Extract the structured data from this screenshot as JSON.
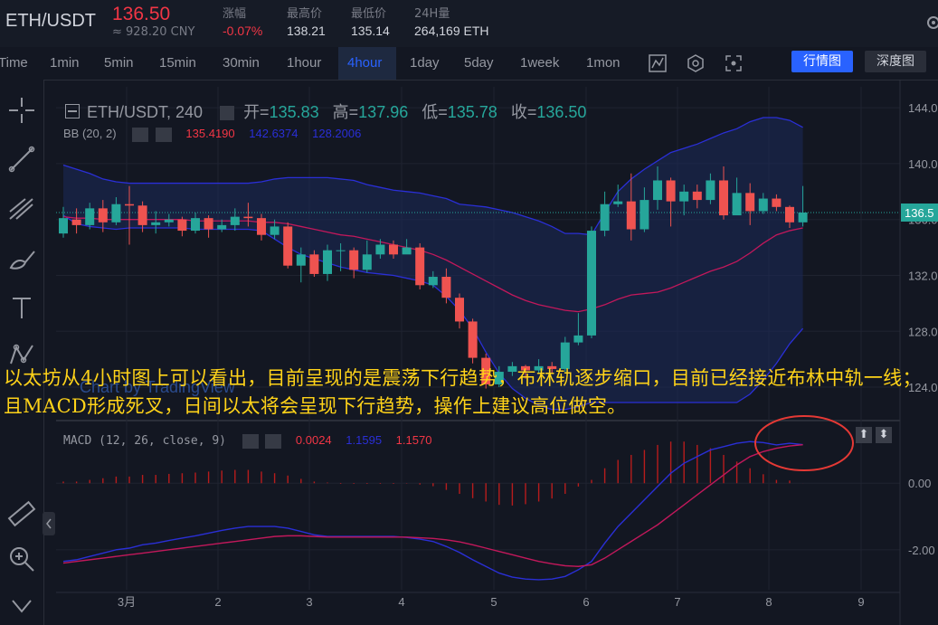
{
  "header": {
    "pair": "ETH/USDT",
    "price": "136.50",
    "cny": "≈ 928.20 CNY",
    "stats": [
      {
        "label": "涨幅",
        "value": "-0.07%",
        "color": "#f23645"
      },
      {
        "label": "最高价",
        "value": "138.21",
        "color": "#d1d4dc"
      },
      {
        "label": "最低价",
        "value": "135.14",
        "color": "#d1d4dc"
      },
      {
        "label": "24H量",
        "value": "264,169 ETH",
        "color": "#d1d4dc"
      }
    ]
  },
  "toolbar": {
    "timeframes": [
      "Time",
      "1min",
      "5min",
      "15min",
      "30min",
      "1hour",
      "4hour",
      "1day",
      "5day",
      "1week",
      "1mon"
    ],
    "active": "4hour",
    "view_primary": "行情图",
    "view_secondary": "深度图",
    "icons": [
      "indicator-icon",
      "settings-icon",
      "fullscreen-icon"
    ]
  },
  "drawing_tools": [
    "crosshair-icon",
    "trendline-icon",
    "fork-icon",
    "brush-icon",
    "text-icon",
    "pattern-icon",
    "ruler-icon",
    "zoom-icon",
    "magnet-icon"
  ],
  "legend": {
    "symbol": "ETH/USDT, 240",
    "open_label": "开=",
    "open": "135.83",
    "high_label": "高=",
    "high": "137.96",
    "low_label": "低=",
    "low": "135.78",
    "close_label": "收=",
    "close": "136.50",
    "bb_label": "BB (20, 2)",
    "bb_values": [
      "135.4190",
      "142.6374",
      "128.2006"
    ],
    "watermark": "Chart by TradingView",
    "macd_label": "MACD (12, 26, close, 9)",
    "macd_values": [
      "0.0024",
      "1.1595",
      "1.1570"
    ]
  },
  "annotation": {
    "text": "以太坊从4小时图上可以看出，目前呈现的是震荡下行趋势，布林轨逐步缩口，目前已经接近布林中轨一线；且MACD形成死叉，日间以太将会呈现下行趋势，操作上建议高位做空。"
  },
  "colors": {
    "up": "#26a69a",
    "down": "#ef5350",
    "bb_upper": "#2a2fd6",
    "bb_mid": "#c2185b",
    "macd": "#2a2fd6",
    "signal": "#c2185b",
    "annotation": "#ffd319",
    "circle": "#e53935"
  },
  "chart_data": [
    {
      "type": "candlestick",
      "y_ticks": [
        124,
        128,
        132,
        136,
        140,
        144
      ],
      "ylim": [
        121.8,
        145.5
      ],
      "x_ticks": [
        "3月",
        "2",
        "3",
        "4",
        "5",
        "6",
        "7",
        "8",
        "9"
      ],
      "current_price": 136.5,
      "candles": [
        [
          135.0,
          136.1,
          136.9,
          134.7
        ],
        [
          136.0,
          135.6,
          136.8,
          135.0
        ],
        [
          135.6,
          136.8,
          137.2,
          135.3
        ],
        [
          136.8,
          135.8,
          137.4,
          135.1
        ],
        [
          135.8,
          137.1,
          137.6,
          135.6
        ],
        [
          137.1,
          137.0,
          138.4,
          134.2
        ],
        [
          137.0,
          135.6,
          137.3,
          135.1
        ],
        [
          135.6,
          135.8,
          136.6,
          135.0
        ],
        [
          135.8,
          136.0,
          136.4,
          135.5
        ],
        [
          136.0,
          135.2,
          136.2,
          134.8
        ],
        [
          135.2,
          136.1,
          136.5,
          135.0
        ],
        [
          136.1,
          135.3,
          136.3,
          134.7
        ],
        [
          135.3,
          135.6,
          136.0,
          135.1
        ],
        [
          135.6,
          136.2,
          136.8,
          135.2
        ],
        [
          136.2,
          136.1,
          137.2,
          135.5
        ],
        [
          136.1,
          134.9,
          136.4,
          134.5
        ],
        [
          134.9,
          135.5,
          136.0,
          134.6
        ],
        [
          135.5,
          132.7,
          135.8,
          132.5
        ],
        [
          132.7,
          133.5,
          134.0,
          131.5
        ],
        [
          133.5,
          132.1,
          133.8,
          131.9
        ],
        [
          132.1,
          133.8,
          134.2,
          131.6
        ],
        [
          133.8,
          133.8,
          134.3,
          132.3
        ],
        [
          133.8,
          132.4,
          134.0,
          131.8
        ],
        [
          132.4,
          133.5,
          134.5,
          132.2
        ],
        [
          133.5,
          134.2,
          134.6,
          133.2
        ],
        [
          134.2,
          133.5,
          134.5,
          133.2
        ],
        [
          133.5,
          134.0,
          134.6,
          133.6
        ],
        [
          134.0,
          131.3,
          134.3,
          131.0
        ],
        [
          131.3,
          131.9,
          132.3,
          131.1
        ],
        [
          131.9,
          130.4,
          132.5,
          130.0
        ],
        [
          130.4,
          128.7,
          130.7,
          128.2
        ],
        [
          128.7,
          126.1,
          128.9,
          125.7
        ],
        [
          126.1,
          124.2,
          126.4,
          123.9
        ],
        [
          124.2,
          125.1,
          125.5,
          124.0
        ],
        [
          125.1,
          125.5,
          125.8,
          124.8
        ],
        [
          125.5,
          125.2,
          125.6,
          124.6
        ],
        [
          125.2,
          125.5,
          126.0,
          125.0
        ],
        [
          125.5,
          125.3,
          125.8,
          125.0
        ],
        [
          125.3,
          127.2,
          127.6,
          125.1
        ],
        [
          127.2,
          127.7,
          129.3,
          127.0
        ],
        [
          127.7,
          135.2,
          135.5,
          127.5
        ],
        [
          135.2,
          137.1,
          138.0,
          134.8
        ],
        [
          137.1,
          137.3,
          138.5,
          136.9
        ],
        [
          137.3,
          135.3,
          139.3,
          134.5
        ],
        [
          135.3,
          137.4,
          138.3,
          135.1
        ],
        [
          137.4,
          138.8,
          139.8,
          136.7
        ],
        [
          138.8,
          137.3,
          139.0,
          135.5
        ],
        [
          137.3,
          138.0,
          138.5,
          136.3
        ],
        [
          138.0,
          137.4,
          138.5,
          136.8
        ],
        [
          137.4,
          138.8,
          139.3,
          137.1
        ],
        [
          138.8,
          136.3,
          139.8,
          136.0
        ],
        [
          136.3,
          137.9,
          139.0,
          137.6
        ],
        [
          137.9,
          136.6,
          138.6,
          135.6
        ],
        [
          136.6,
          137.5,
          137.9,
          136.4
        ],
        [
          137.5,
          136.9,
          137.8,
          136.6
        ],
        [
          136.9,
          135.8,
          137.0,
          135.4
        ],
        [
          135.8,
          136.5,
          138.4,
          135.5
        ]
      ],
      "bb_upper": [
        139.9,
        139.6,
        139.3,
        138.9,
        138.7,
        138.6,
        138.6,
        138.6,
        138.6,
        138.6,
        138.6,
        138.6,
        138.6,
        138.6,
        138.6,
        138.7,
        138.9,
        139.0,
        139.0,
        139.0,
        139.0,
        138.9,
        138.8,
        138.5,
        138.3,
        138.1,
        138.0,
        137.9,
        137.7,
        137.5,
        137.1,
        137.0,
        136.9,
        136.7,
        136.5,
        136.2,
        135.9,
        135.5,
        135.0,
        135.0,
        134.9,
        136.5,
        138.0,
        138.9,
        139.6,
        140.2,
        140.8,
        141.1,
        141.4,
        141.8,
        142.2,
        142.5,
        143.0,
        143.3,
        143.3,
        143.1,
        142.6
      ],
      "bb_mid": [
        136.2,
        136.1,
        136.1,
        136.0,
        136.0,
        136.0,
        136.0,
        136.0,
        136.0,
        136.0,
        135.9,
        135.9,
        135.9,
        135.9,
        135.9,
        135.8,
        135.8,
        135.7,
        135.5,
        135.3,
        135.1,
        134.9,
        134.8,
        134.6,
        134.4,
        134.2,
        134.0,
        133.8,
        133.5,
        133.1,
        132.6,
        132.1,
        131.6,
        131.1,
        130.6,
        130.2,
        129.9,
        129.7,
        129.5,
        129.4,
        129.6,
        129.9,
        130.3,
        130.6,
        130.7,
        130.8,
        131.1,
        131.5,
        131.9,
        132.3,
        132.6,
        133.0,
        133.6,
        134.3,
        134.9,
        135.2,
        135.4
      ],
      "bb_lower": [
        136.3,
        135.7,
        135.5,
        135.4,
        135.3,
        135.4,
        135.4,
        135.4,
        135.4,
        135.4,
        135.3,
        135.3,
        135.3,
        135.3,
        135.3,
        135.2,
        134.6,
        134.0,
        133.5,
        133.2,
        132.9,
        132.6,
        132.4,
        132.2,
        132.1,
        132.0,
        131.8,
        131.6,
        131.3,
        130.5,
        129.5,
        128.2,
        126.5,
        125.0,
        123.9,
        123.2,
        122.7,
        122.4,
        122.4,
        122.6,
        122.9,
        122.9,
        122.9,
        122.9,
        122.9,
        122.9,
        122.9,
        122.9,
        122.9,
        122.9,
        122.9,
        122.9,
        123.5,
        124.5,
        125.7,
        127.1,
        128.2
      ]
    },
    {
      "type": "macd",
      "y_ticks": [
        -2.0,
        0.0
      ],
      "ylim": [
        -3.2,
        1.8
      ],
      "macd": [
        -2.35,
        -2.3,
        -2.2,
        -2.1,
        -2.0,
        -1.95,
        -1.85,
        -1.8,
        -1.72,
        -1.65,
        -1.58,
        -1.5,
        -1.42,
        -1.35,
        -1.3,
        -1.3,
        -1.3,
        -1.35,
        -1.45,
        -1.55,
        -1.6,
        -1.6,
        -1.6,
        -1.6,
        -1.6,
        -1.6,
        -1.63,
        -1.68,
        -1.75,
        -1.9,
        -2.08,
        -2.3,
        -2.5,
        -2.7,
        -2.82,
        -2.88,
        -2.9,
        -2.88,
        -2.8,
        -2.6,
        -2.35,
        -1.8,
        -1.3,
        -0.9,
        -0.5,
        -0.1,
        0.3,
        0.6,
        0.8,
        1.0,
        1.1,
        1.2,
        1.25,
        1.22,
        1.15,
        1.2,
        1.16
      ],
      "signal": [
        -2.4,
        -2.35,
        -2.3,
        -2.25,
        -2.2,
        -2.15,
        -2.1,
        -2.05,
        -2.0,
        -1.95,
        -1.9,
        -1.85,
        -1.8,
        -1.75,
        -1.7,
        -1.65,
        -1.6,
        -1.58,
        -1.58,
        -1.6,
        -1.62,
        -1.62,
        -1.62,
        -1.62,
        -1.62,
        -1.62,
        -1.62,
        -1.64,
        -1.66,
        -1.7,
        -1.76,
        -1.85,
        -1.95,
        -2.05,
        -2.15,
        -2.25,
        -2.35,
        -2.42,
        -2.48,
        -2.5,
        -2.45,
        -2.25,
        -2.0,
        -1.75,
        -1.5,
        -1.25,
        -0.95,
        -0.65,
        -0.35,
        -0.05,
        0.25,
        0.55,
        0.8,
        0.95,
        1.05,
        1.12,
        1.157
      ],
      "histogram": [
        0.05,
        0.05,
        0.1,
        0.15,
        0.2,
        0.2,
        0.25,
        0.25,
        0.28,
        0.3,
        0.32,
        0.35,
        0.38,
        0.4,
        0.4,
        0.35,
        0.3,
        0.23,
        0.13,
        0.05,
        0.02,
        -0.02,
        -0.02,
        -0.02,
        -0.02,
        -0.02,
        -0.01,
        -0.04,
        -0.09,
        -0.2,
        -0.32,
        -0.45,
        -0.55,
        -0.65,
        -0.67,
        -0.63,
        -0.55,
        -0.46,
        -0.32,
        -0.1,
        0.1,
        0.45,
        0.7,
        0.85,
        1.0,
        1.15,
        1.25,
        1.25,
        1.15,
        1.05,
        0.85,
        0.65,
        0.45,
        0.27,
        0.1,
        0.08,
        0.002
      ]
    }
  ]
}
